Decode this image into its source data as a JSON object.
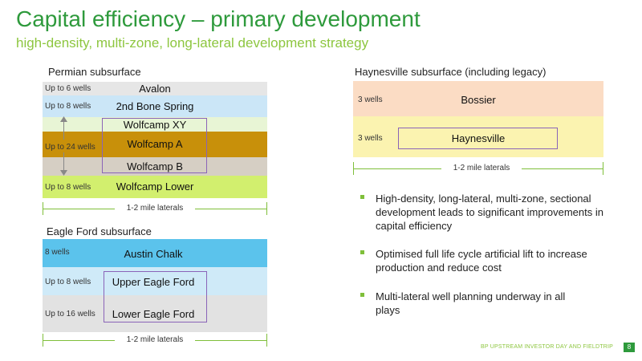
{
  "header": {
    "title": "Capital efficiency – primary development",
    "subtitle": "high-density, multi-zone, long-lateral development strategy"
  },
  "permian": {
    "title": "Permian subsurface",
    "rows": [
      {
        "wells": "Up to 6 wells",
        "formation": "Avalon",
        "color": "#e6e6e6"
      },
      {
        "wells": "Up to 8 wells",
        "formation": "2nd Bone Spring",
        "color": "#cbe6f7"
      },
      {
        "wells": "",
        "formation": "Wolfcamp XY",
        "color": "#e8f5d5"
      },
      {
        "wells": "Up to 24 wells",
        "formation": "Wolfcamp A",
        "color": "#c8900a"
      },
      {
        "wells": "",
        "formation": "Wolfcamp B",
        "color": "#d6cfc4"
      },
      {
        "wells": "Up to 8 wells",
        "formation": "Wolfcamp Lower",
        "color": "#d2ef6e"
      }
    ],
    "laterals": "1-2 mile laterals"
  },
  "eagle_ford": {
    "title": "Eagle Ford subsurface",
    "rows": [
      {
        "wells": "8 wells",
        "formation": "Austin Chalk",
        "color": "#5bc3ec"
      },
      {
        "wells": "Up to 8 wells",
        "formation": "Upper Eagle Ford",
        "color": "#cfeaf8"
      },
      {
        "wells": "Up to 16 wells",
        "formation": "Lower Eagle Ford",
        "color": "#e2e2e2"
      }
    ],
    "laterals": "1-2 mile laterals"
  },
  "haynesville": {
    "title": "Haynesville subsurface (including legacy)",
    "rows": [
      {
        "wells": "3 wells",
        "formation": "Bossier",
        "color": "#fbdcc4"
      },
      {
        "wells": "3 wells",
        "formation": "Haynesville",
        "color": "#fbf3b0"
      }
    ],
    "laterals": "1-2 mile laterals"
  },
  "bullets": [
    "High-density, long-lateral, multi-zone, sectional development leads to significant improvements in capital efficiency",
    "Optimised full life cycle artificial lift to increase production and reduce cost",
    "Multi-lateral well planning underway in all plays"
  ],
  "footer": {
    "text": "BP UPSTREAM INVESTOR DAY AND FIELDTRIP",
    "page": "8"
  },
  "colors": {
    "brand_green": "#2e9a3c",
    "light_green": "#8dc63f",
    "box_outline": "#8a64b8"
  }
}
